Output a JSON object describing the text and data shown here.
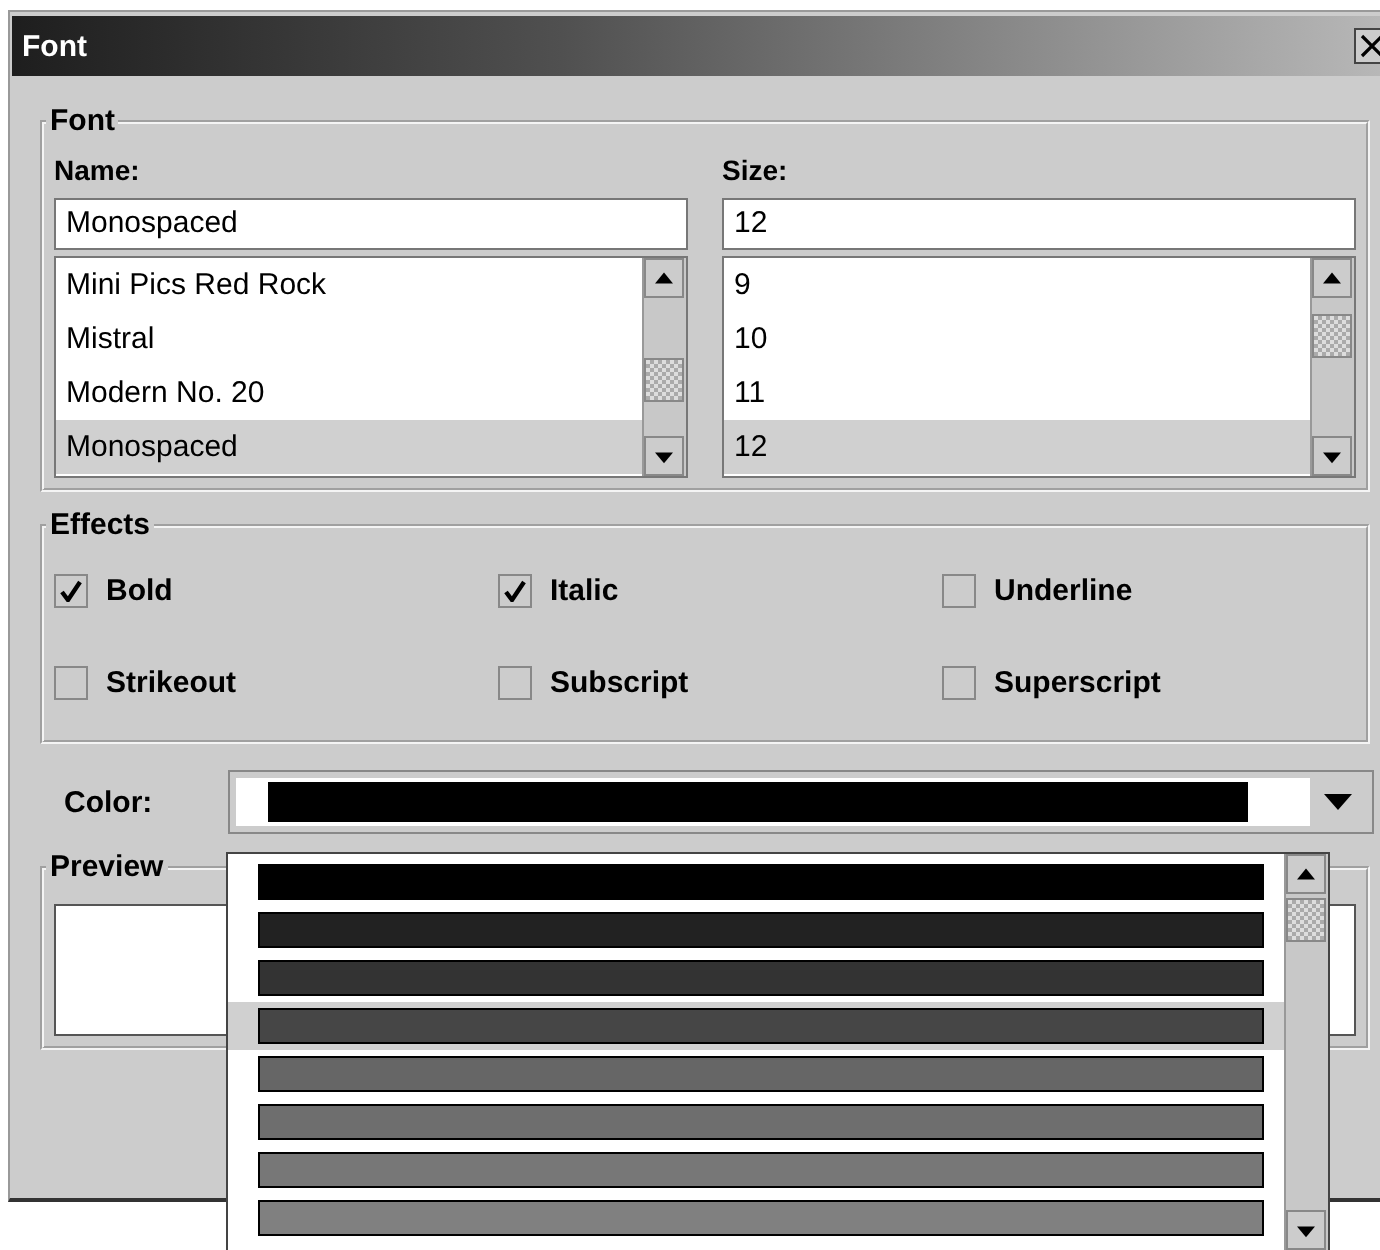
{
  "window": {
    "title": "Font"
  },
  "font_group": {
    "title": "Font",
    "name": {
      "label": "Name:",
      "value": "Monospaced",
      "items": [
        {
          "label": "Mini Pics Red Rock",
          "selected": false
        },
        {
          "label": "Mistral",
          "selected": false
        },
        {
          "label": "Modern No. 20",
          "selected": false
        },
        {
          "label": "Monospaced",
          "selected": true
        }
      ]
    },
    "size": {
      "label": "Size:",
      "value": "12",
      "items": [
        {
          "label": "9",
          "selected": false
        },
        {
          "label": "10",
          "selected": false
        },
        {
          "label": "11",
          "selected": false
        },
        {
          "label": "12",
          "selected": true
        }
      ]
    }
  },
  "effects": {
    "title": "Effects",
    "options": [
      {
        "label": "Bold",
        "checked": true
      },
      {
        "label": "Italic",
        "checked": true
      },
      {
        "label": "Underline",
        "checked": false
      },
      {
        "label": "Strikeout",
        "checked": false
      },
      {
        "label": "Subscript",
        "checked": false
      },
      {
        "label": "Superscript",
        "checked": false
      }
    ]
  },
  "color_field": {
    "label": "Color:",
    "swatch": {
      "color": "#000000"
    },
    "options": [
      {
        "color": "#000000",
        "selected": false
      },
      {
        "color": "#222222",
        "selected": false
      },
      {
        "color": "#333333",
        "selected": false
      },
      {
        "color": "#464646",
        "selected": true
      },
      {
        "color": "#666666",
        "selected": false
      },
      {
        "color": "#6e6e6e",
        "selected": false
      },
      {
        "color": "#777777",
        "selected": false
      },
      {
        "color": "#808080",
        "selected": false
      }
    ]
  },
  "preview": {
    "title": "Preview"
  }
}
